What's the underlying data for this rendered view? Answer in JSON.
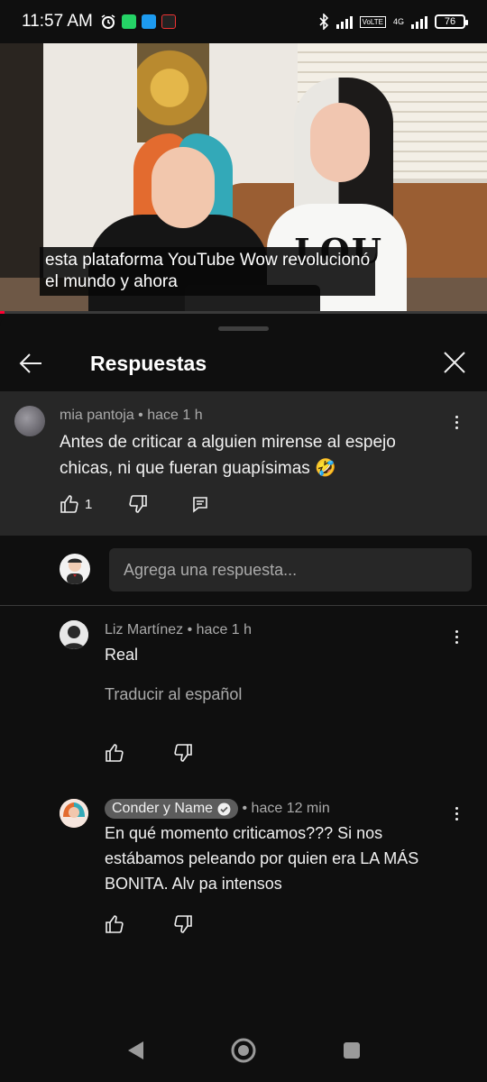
{
  "status_bar": {
    "time": "11:57 AM",
    "network": "4G",
    "volte": "VoLTE",
    "battery": "76",
    "left_icons": [
      "alarm-icon",
      "whatsapp-icon",
      "twitter-icon",
      "app-icon"
    ]
  },
  "video": {
    "caption_line1": "esta plataforma YouTube Wow revolucionó",
    "caption_line2": "el mundo y ahora",
    "shirt_print": "LOU",
    "progress_fraction": 0.01
  },
  "panel": {
    "title": "Respuestas"
  },
  "parent_comment": {
    "author": "mia pantoja",
    "time": "hace 1 h",
    "text": "Antes de criticar a alguien mirense al espejo chicas, ni que fueran guapísimas 🤣",
    "likes": "1"
  },
  "reply_input": {
    "placeholder": "Agrega una respuesta..."
  },
  "replies": [
    {
      "author": "Liz Martínez",
      "time": "hace 1 h",
      "text": "Real",
      "translate": "Traducir al español"
    },
    {
      "author": "Conder y Name",
      "time": "hace 12 min",
      "text": "En qué momento criticamos??? Si nos estábamos peleando por quien era LA MÁS BONITA. Alv pa intensos",
      "verified": true
    }
  ],
  "colors": {
    "background": "#0f0f0f",
    "surface": "#272727",
    "secondary_text": "#aaaaaa",
    "accent": "#ff0033"
  }
}
